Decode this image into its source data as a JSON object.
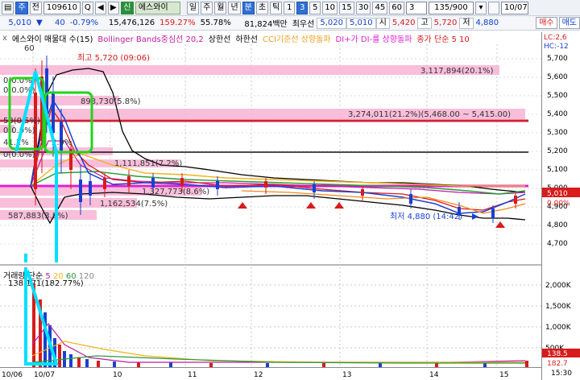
{
  "toolbar": {
    "window_menu_label": "▤",
    "tab_stock_label": "주",
    "tab_prev_label": "전",
    "code_value": "109610",
    "search_label": "Q",
    "prev_arrow": "◀",
    "next_arrow": "▶",
    "sin_label": "신",
    "stock_name": "에스와이",
    "period_day": "일",
    "period_week": "주",
    "period_month": "월",
    "period_year": "년",
    "period_min": "분",
    "period_sec": "초",
    "period_tick": "틱",
    "intervals": [
      "1",
      "3",
      "5",
      "10",
      "15",
      "30",
      "45",
      "60"
    ],
    "interval_input": "3",
    "count_value": "135/900",
    "date_value": "10/07"
  },
  "quote": {
    "price": "5,010",
    "change_arrow": "▼",
    "change": "40",
    "change_rate": "-0.79%",
    "volume": "15,476,126",
    "volume_ratio": "159.27%",
    "turnover_rate": "55.78%",
    "amount": "81,824백만",
    "best_ask_label": "최우선",
    "best_ask": "5,020",
    "best_bid": "5,010",
    "open_label": "시",
    "open": "5,420",
    "high_label": "고",
    "high": "5,720",
    "low_label": "저",
    "low": "4,880",
    "buy_label": "매수",
    "sell_label": "매도"
  },
  "legend": {
    "close_label": "x",
    "title": "에스와이 매물대 수(15)",
    "bollinger": "Bollinger Bands중심선 20,2",
    "upper": "상한선",
    "lower": "하한선",
    "cci": "CCI기준선 상향돌파",
    "dmi": "DI+가 DI-를 상향돌파",
    "ma": "종가 단순 5  10"
  },
  "vol_legend": {
    "title": "거래량 단순",
    "p5": "5",
    "p20": "20",
    "p60": "60",
    "p120": "120",
    "value": "138,171(182.77%)"
  },
  "right_axis": {
    "top_a": "LC:2,6",
    "top_b": "HC:-12",
    "price_ticks": [
      "5,700",
      "5,600",
      "5,500",
      "5,400",
      "5,300",
      "5,200",
      "5,100",
      "5,000",
      "4,900",
      "4,800",
      "4,700"
    ],
    "current_price_tag": "5,010",
    "current_rate_tag": "0.00%",
    "vol_ticks": [
      "2,000K",
      "1,500K",
      "1,000K",
      "500K"
    ],
    "vol_tag_a": "138.5",
    "vol_tag_b": "182.7"
  },
  "date_axis": {
    "labels": [
      "10/06",
      "10/07",
      "10",
      "11",
      "12",
      "13",
      "14",
      "15",
      "15:30"
    ]
  },
  "annotations": {
    "high": "최고 5,720 (09:06)",
    "low": "최저 4,880 (14:42)",
    "vp1": "3,117,894(20.1%)",
    "vp2": "898,730(5.8%)",
    "vp3": "3,274,011(21.2%)(5,468.00 ~ 5,415.00)",
    "vp4": "1,111,851(7.2%)",
    "vp5": "1,327,773(8.6%)",
    "vp6": "1,162,534(7.5%)",
    "vp7": "587,883(3.8%)",
    "vp8": "41.2%",
    "vp9": "2.9%",
    "z1": "0(0.0%)",
    "z2": "0(0.0%)",
    "z3": "0(0.0%)",
    "z4": "0(0.0%)",
    "z5": "53(0.5%)",
    "z6": "60"
  },
  "colors": {
    "bollinger_mid": "#c01aa4",
    "bollinger_band": "#000000",
    "ma5": "#1a3fd0",
    "ma10": "#d81b1b",
    "ma20": "#f2b21a",
    "ma60": "#2a9a3a",
    "volume_profile": "#f7b3d4",
    "support_line": "#d0223a",
    "accent_magenta": "#e020d0",
    "cyan_mark": "#00e0ff",
    "green_mark": "#22d31b"
  }
}
